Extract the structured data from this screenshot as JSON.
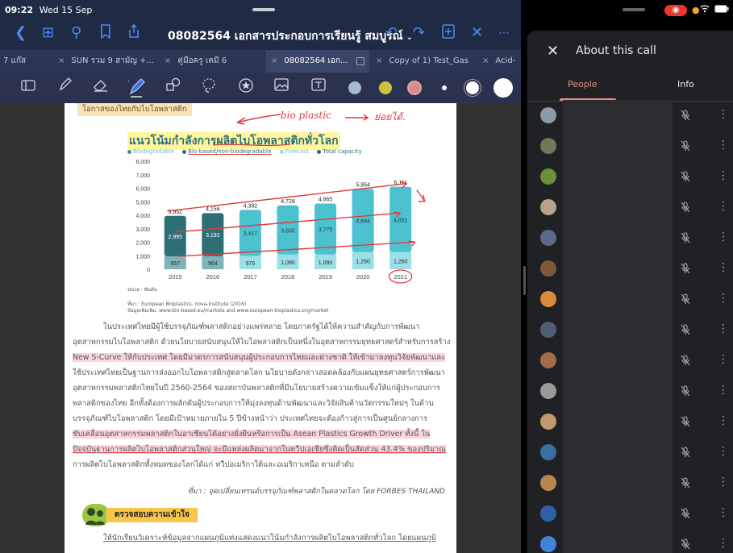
{
  "status": {
    "time": "09:22",
    "date": "Wed 15 Sep"
  },
  "toolbar": {
    "doc_title": "08082564 เอกสารประกอบการเรียนรู้ สมบูรณ์",
    "title_chevron": "⌄"
  },
  "tabs": [
    {
      "label": "7 แก๊ส",
      "close": ""
    },
    {
      "label": "SUN รวม 9 สามัญ +...",
      "close": "×"
    },
    {
      "label": "คู่มือครู เคมี 6",
      "close": "×"
    },
    {
      "label": "08082564 เอก...",
      "close": "×"
    },
    {
      "label": "Copy of 1) Test_Gas",
      "close": "×"
    },
    {
      "label": "Acid-",
      "close": "×"
    }
  ],
  "colors": {
    "accent": "#4f8af5",
    "swatch_gray": "#a7b8cf",
    "swatch_yellow": "#c9c43a",
    "swatch_pink": "#d88d8d",
    "meet_accent": "#f28b82"
  },
  "page": {
    "header": "โอกาสของไทยกับไบโอพลาสติก",
    "hand_note_1": "bio plastic",
    "hand_note_2": "ย่อยได้.",
    "chart_title": "แนวโน้มกำลังการผลิตไบโอพลาสติกทั่วโลก",
    "legend": [
      "Biodegradable",
      "Bio-based/non-biodegradable",
      "Forecast",
      "Total capacity"
    ],
    "unit": "หน่วย : พันตัน",
    "source_1": "ที่มา : European Bioplastics, nova-Institute (2016)",
    "source_2": "ข้อมูลเพิ่มเติม: www.bio-based.eu/markets and www.european-bioplastics.org/market",
    "para": [
      "ในประเทศไทยมีผู้ใช้บรรจุภัณฑ์พลาสติกอย่างแพร่หลาย โดยภาครัฐได้ให้ความสำคัญกับการพัฒนา",
      "อุตสาหกรรมไบโอพลาสติก ด้วยนโยบายสนับสนุนให้ไบโอพลาสติกเป็นหนึ่งในอุตสาหกรรมยุทธศาสตร์สำหรับการสร้าง",
      "New S-Curve ให้กับประเทศ โดยมีมาตรการสนับสนุนผู้ประกอบการไทยและต่างชาติ ให้เข้ามาลงทุนวิจัยพัฒนาและ",
      "ใช้ประเทศไทยเป็นฐานการส่งออกไบโอพลาสติกสู่ตลาดโลก นโยบายดังกล่าวสอดคล้องกับแผนยุทธศาสตร์การพัฒนา",
      "อุตสาหกรรมพลาสติกไทยในปี 2560-2564 ของสถาบันพลาสติกที่มีนโยบายสร้างความเข้มแข็งให้แก่ผู้ประกอบการ",
      "พลาสติกของไทย อีกทั้งต้องการผลักดันผู้ประกอบการให้มุ่งลงทุนด้านพัฒนาและวิจัยสินค้านวัตกรรมใหม่ๆ ในด้าน",
      "บรรจุภัณฑ์ไบโอพลาสติก โดยมีเป้าหมายภายใน 5 ปีข้างหน้าว่า ประเทศไทยจะต้องก้าวสู่การเป็นศูนย์กลางการ",
      "ขับเคลื่อนอุตสาหกรรมพลาสติกในอาเซียนได้อย่างยั่งยืนหรือการเป็น Asean Plastics Growth Driver ทั้งนี้ ใน",
      "ปัจจุบันฐานการผลิตไบโอพลาสติกส่วนใหญ่ จะมีแหล่งผลิตมาจากในทวีปเอเชียซึ่งคิดเป็นสัดส่วน 43.4% ของปริมาณ",
      "การผลิตไบโอพลาสติกทั้งหมดของโลกได้แก่ ทวีปอเมริกาใต้และอเมริกาเหนือ ตามลำดับ"
    ],
    "quote": "ที่มา : จุดเปลี่ยนเทรนด์บรรจุภัณฑ์พลาสติกในตลาดโลก โดย FORBES THAILAND",
    "check_label": "ตรวจสอบความเข้าใจ",
    "instruction": "ให้นักเรียนวิเคราะห์ข้อมูลจากแผนภูมิแท่งแสดงแนวโน้มกำลังการผลิตไบโอพลาสติกทั่วโลก โดยแผนภูมิ"
  },
  "chart_data": {
    "type": "bar",
    "title": "แนวโน้มกำลังการผลิตไบโอพลาสติกทั่วโลก",
    "categories": [
      "2015",
      "2016",
      "2017",
      "2018",
      "2019",
      "2020",
      "2021"
    ],
    "series": [
      {
        "name": "Biodegradable",
        "values": [
          957,
          964,
          975,
          1090,
          1090,
          1260,
          1260
        ]
      },
      {
        "name": "Bio-based/non-biodegradable",
        "values": [
          2995,
          3192,
          3417,
          3630,
          3775,
          4694,
          4851
        ]
      },
      {
        "name": "Total capacity",
        "values": [
          3952,
          4156,
          4392,
          4728,
          4865,
          5954,
          6111
        ]
      }
    ],
    "forecast_from": "2017",
    "yticks": [
      "0",
      "1,000",
      "2,000",
      "3,000",
      "4,000",
      "5,000",
      "6,000",
      "7,000",
      "8,000"
    ],
    "ylim": [
      0,
      8000
    ],
    "ylabel": "หน่วย : พันตัน",
    "colors": {
      "biodegradable": "#2e6f75",
      "bio_based": "#4cc2d0",
      "forecast": "#9be0e8"
    }
  },
  "meet": {
    "panel_title": "About this call",
    "tabs": [
      "People",
      "Info"
    ],
    "participants": [
      {
        "avatar_color": "#8e9aa8"
      },
      {
        "avatar_color": "#6c7a55"
      },
      {
        "avatar_color": "#6b8f3a"
      },
      {
        "avatar_color": "#b8a38a"
      },
      {
        "avatar_color": "#5a6a88"
      },
      {
        "avatar_color": "#7d5a3c"
      },
      {
        "avatar_color": "#d98a3a"
      },
      {
        "avatar_color": "#4f5d75"
      },
      {
        "avatar_color": "#a56b4a"
      },
      {
        "avatar_color": "#9a9a9a"
      },
      {
        "avatar_color": "#c19a6b"
      },
      {
        "avatar_color": "#3b6ea5"
      },
      {
        "avatar_color": "#b8874e"
      },
      {
        "avatar_color": "#2f5fa8"
      },
      {
        "avatar_color": "#3f84d8"
      }
    ]
  }
}
